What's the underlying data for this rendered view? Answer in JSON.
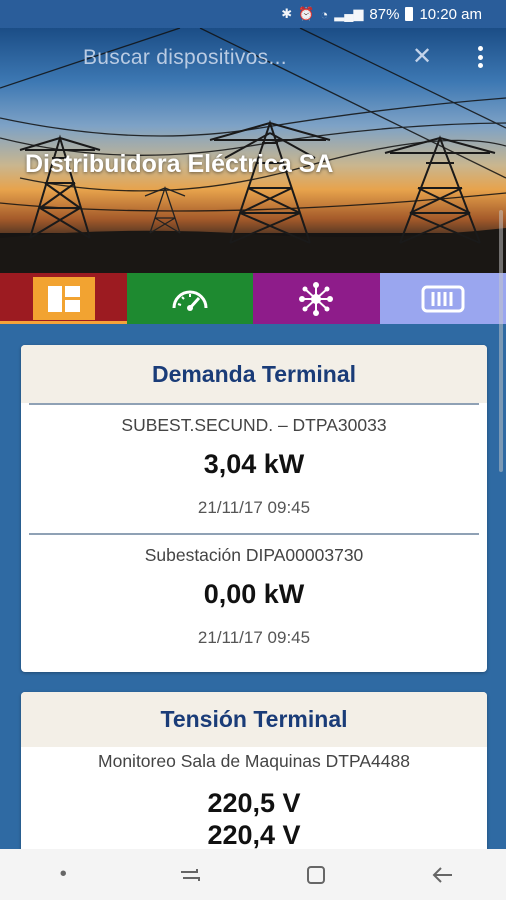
{
  "status_bar": {
    "battery": "87%",
    "time": "10:20 am"
  },
  "header": {
    "search_placeholder": "Buscar dispositivos...",
    "company_name": "Distribuidora Eléctrica SA"
  },
  "tabs": [
    {
      "name": "dashboard",
      "icon": "dashboard-icon",
      "color": "#9c1b21",
      "selected": true
    },
    {
      "name": "gauge",
      "icon": "speedometer-icon",
      "color": "#1e8a30",
      "selected": false
    },
    {
      "name": "network",
      "icon": "network-icon",
      "color": "#8e1c8a",
      "selected": false
    },
    {
      "name": "meter",
      "icon": "meter-icon",
      "color": "#9aa6ef",
      "selected": false
    }
  ],
  "demand_card": {
    "title": "Demanda Terminal",
    "items": [
      {
        "device": "SUBEST.SECUND. – DTPA30033",
        "value": "3,04 kW",
        "timestamp": "21/11/17 09:45"
      },
      {
        "device": "Subestación DIPA00003730",
        "value": "0,00 kW",
        "timestamp": "21/11/17 09:45"
      }
    ]
  },
  "tension_card": {
    "title": "Tensión Terminal",
    "device": "Monitoreo Sala de Maquinas DTPA4488",
    "values": [
      "220,5 V",
      "220,4 V"
    ]
  }
}
